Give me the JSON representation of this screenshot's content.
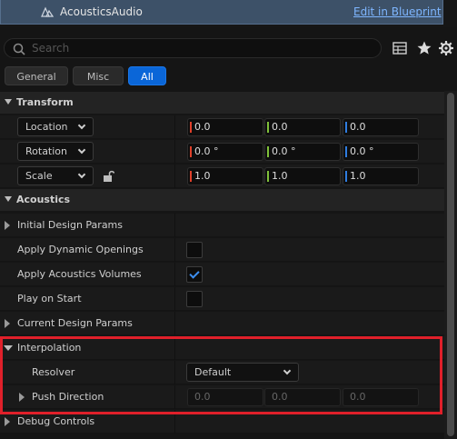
{
  "header": {
    "component_name": "AcousticsAudio",
    "edit_link": "Edit in Blueprint"
  },
  "search": {
    "placeholder": "Search"
  },
  "toolbar_icons": [
    "table-view-icon",
    "star-icon",
    "settings-icon"
  ],
  "filter_tabs": [
    {
      "label": "General",
      "active": false
    },
    {
      "label": "Misc",
      "active": false
    },
    {
      "label": "All",
      "active": true
    }
  ],
  "transform": {
    "title": "Transform",
    "location": {
      "label": "Location",
      "x": "0.0",
      "y": "0.0",
      "z": "0.0"
    },
    "rotation": {
      "label": "Rotation",
      "x": "0.0 °",
      "y": "0.0 °",
      "z": "0.0 °"
    },
    "scale": {
      "label": "Scale",
      "x": "1.0",
      "y": "1.0",
      "z": "1.0"
    }
  },
  "acoustics": {
    "title": "Acoustics",
    "initial_design_params": "Initial Design Params",
    "apply_dynamic_openings": {
      "label": "Apply Dynamic Openings",
      "checked": false
    },
    "apply_acoustics_volumes": {
      "label": "Apply Acoustics Volumes",
      "checked": true
    },
    "play_on_start": {
      "label": "Play on Start",
      "checked": false
    },
    "current_design_params": "Current Design Params",
    "interpolation": {
      "title": "Interpolation",
      "resolver": {
        "label": "Resolver",
        "value": "Default"
      },
      "push_direction": {
        "label": "Push Direction",
        "x": "0.0",
        "y": "0.0",
        "z": "0.0"
      }
    },
    "debug_controls": "Debug Controls"
  },
  "colors": {
    "axis_x": "#e0402a",
    "axis_y": "#7fc03a",
    "axis_z": "#2f7de0",
    "accent": "#0a66d8",
    "highlight": "#e0202a"
  }
}
